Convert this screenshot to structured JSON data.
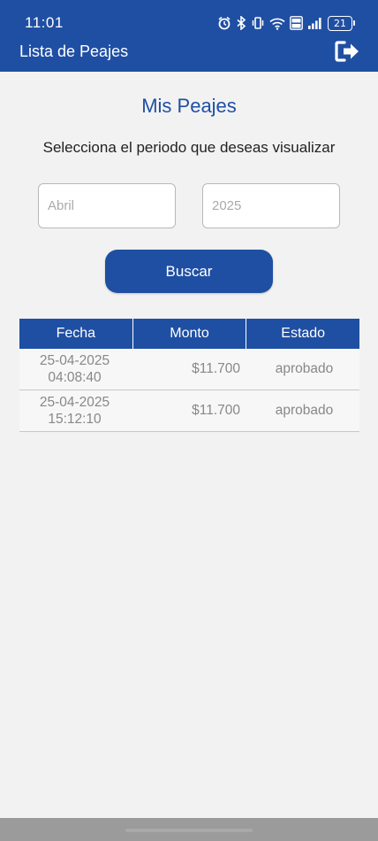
{
  "status_bar": {
    "time": "11:01",
    "battery": "21"
  },
  "appbar": {
    "title": "Lista de Peajes",
    "logout_icon": "logout-icon"
  },
  "main": {
    "title": "Mis Peajes",
    "subtitle": "Selecciona el periodo que deseas visualizar",
    "month_placeholder": "Abril",
    "year_placeholder": "2025",
    "search_label": "Buscar"
  },
  "table": {
    "headers": [
      "Fecha",
      "Monto",
      "Estado"
    ],
    "rows": [
      {
        "date": "25-04-2025",
        "time": "04:08:40",
        "amount": "$11.700",
        "status": "aprobado"
      },
      {
        "date": "25-04-2025",
        "time": "15:12:10",
        "amount": "$11.700",
        "status": "aprobado"
      }
    ]
  },
  "colors": {
    "primary": "#1f4fa3",
    "background": "#f2f2f2"
  }
}
